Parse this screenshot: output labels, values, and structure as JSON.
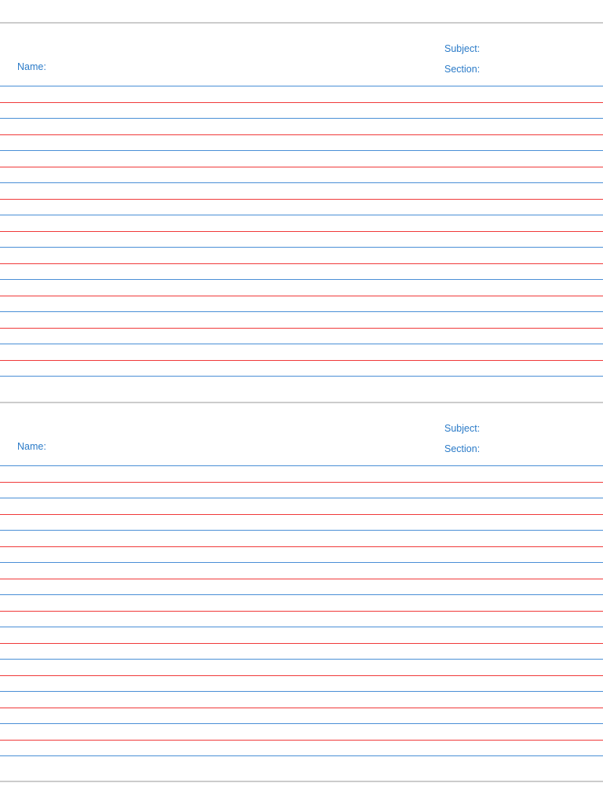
{
  "sheets": [
    {
      "name_label": "Name:",
      "subject_label": "Subject:",
      "section_label": "Section:"
    },
    {
      "name_label": "Name:",
      "subject_label": "Subject:",
      "section_label": "Section:"
    }
  ],
  "lines_per_sheet": 19,
  "colors": {
    "blue_line": "#4a8fd6",
    "red_line": "#f03a3a",
    "label": "#2b7bc8",
    "separator": "#cccccc"
  }
}
